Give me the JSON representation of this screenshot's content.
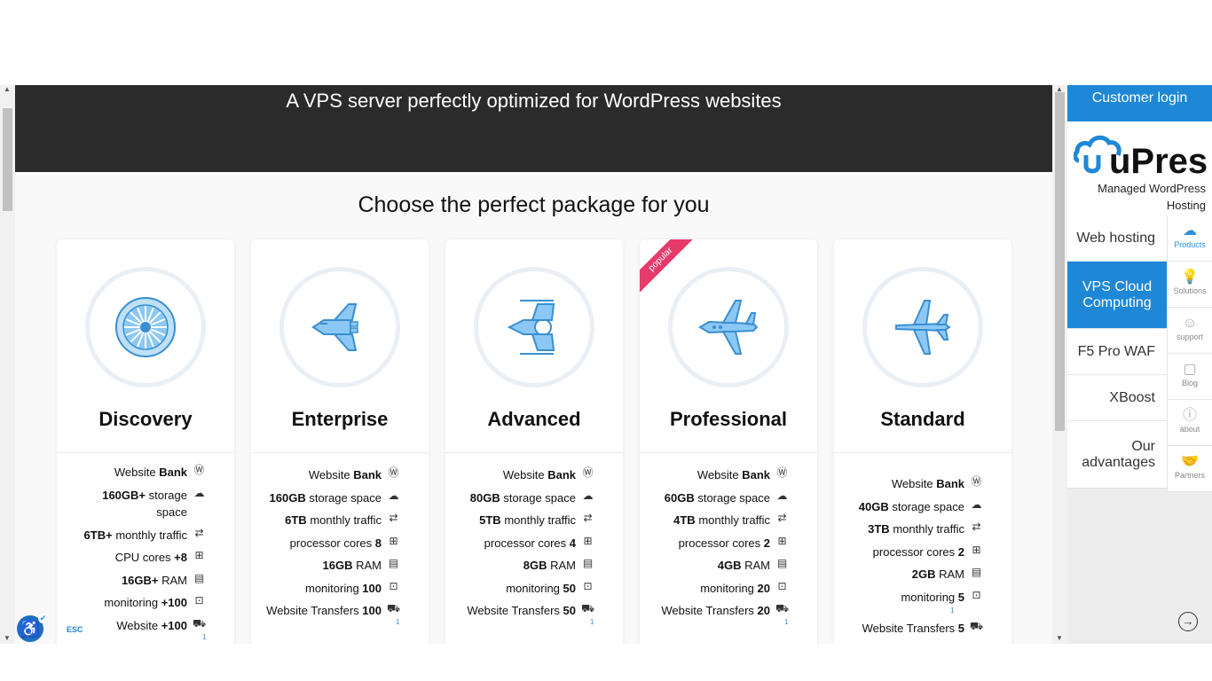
{
  "hero": {
    "title": "A VPS server perfectly optimized for WordPress websites"
  },
  "section": {
    "title": "Choose the perfect package for you"
  },
  "cards": [
    {
      "name": "Discovery",
      "icon": "turbine-icon",
      "features": [
        {
          "pre": "Website ",
          "bold": "Bank",
          "icon": "wordpress-icon"
        },
        {
          "pre": "",
          "bold": "160GB+",
          "post": " storage",
          "post2": "space",
          "icon": "cloud-icon"
        },
        {
          "pre": "",
          "bold": "6TB+",
          "post": " monthly traffic",
          "icon": "transfer-arrows-icon"
        },
        {
          "pre": "CPU cores ",
          "bold": "+8",
          "icon": "cpu-icon"
        },
        {
          "pre": "",
          "bold": "16GB+",
          "post": " RAM",
          "icon": "ram-icon"
        },
        {
          "pre": "monitoring ",
          "bold": "+100",
          "icon": "monitor-icon"
        },
        {
          "pre": "Website ",
          "bold": "+100",
          "icon": "truck-icon"
        }
      ],
      "sup": "1"
    },
    {
      "name": "Enterprise",
      "icon": "space-shuttle-icon",
      "features": [
        {
          "pre": "Website ",
          "bold": "Bank",
          "icon": "wordpress-icon"
        },
        {
          "pre": "",
          "bold": "160GB",
          "post": " storage space",
          "icon": "cloud-icon"
        },
        {
          "pre": "",
          "bold": "6TB",
          "post": " monthly traffic",
          "icon": "transfer-arrows-icon"
        },
        {
          "pre": "processor cores ",
          "bold": "8",
          "icon": "cpu-icon"
        },
        {
          "pre": "",
          "bold": "16GB",
          "post": " RAM",
          "icon": "ram-icon"
        },
        {
          "pre": "monitoring ",
          "bold": "100",
          "icon": "monitor-icon"
        },
        {
          "pre": "Website Transfers ",
          "bold": "100",
          "icon": "truck-icon"
        }
      ],
      "sup": "1"
    },
    {
      "name": "Advanced",
      "icon": "starfighter-icon",
      "features": [
        {
          "pre": "Website ",
          "bold": "Bank",
          "icon": "wordpress-icon"
        },
        {
          "pre": "",
          "bold": "80GB",
          "post": " storage space",
          "icon": "cloud-icon"
        },
        {
          "pre": "",
          "bold": "5TB",
          "post": " monthly traffic",
          "icon": "transfer-arrows-icon"
        },
        {
          "pre": "processor cores ",
          "bold": "4",
          "icon": "cpu-icon"
        },
        {
          "pre": "",
          "bold": "8GB",
          "post": " RAM",
          "icon": "ram-icon"
        },
        {
          "pre": "monitoring ",
          "bold": "50",
          "icon": "monitor-icon"
        },
        {
          "pre": "Website Transfers ",
          "bold": "50",
          "icon": "truck-icon"
        }
      ],
      "sup": "1"
    },
    {
      "name": "Professional",
      "icon": "jet-icon",
      "ribbon": "popular",
      "features": [
        {
          "pre": "Website ",
          "bold": "Bank",
          "icon": "wordpress-icon"
        },
        {
          "pre": "",
          "bold": "60GB",
          "post": " storage space",
          "icon": "cloud-icon"
        },
        {
          "pre": "",
          "bold": "4TB",
          "post": " monthly traffic",
          "icon": "transfer-arrows-icon"
        },
        {
          "pre": "processor cores ",
          "bold": "2",
          "icon": "cpu-icon"
        },
        {
          "pre": "",
          "bold": "4GB",
          "post": " RAM",
          "icon": "ram-icon"
        },
        {
          "pre": "monitoring ",
          "bold": "20",
          "icon": "monitor-icon"
        },
        {
          "pre": "Website Transfers ",
          "bold": "20",
          "icon": "truck-icon"
        }
      ],
      "sup": "1"
    },
    {
      "name": "Standard",
      "icon": "airplane-icon",
      "features": [
        {
          "pre": "Website ",
          "bold": "Bank",
          "icon": "wordpress-icon"
        },
        {
          "pre": "",
          "bold": "40GB",
          "post": " storage space",
          "icon": "cloud-icon"
        },
        {
          "pre": "",
          "bold": "3TB",
          "post": " monthly traffic",
          "icon": "transfer-arrows-icon"
        },
        {
          "pre": "processor cores ",
          "bold": "2",
          "icon": "cpu-icon"
        },
        {
          "pre": "",
          "bold": "2GB",
          "post": " RAM",
          "icon": "ram-icon"
        },
        {
          "pre": "monitoring ",
          "bold": "5",
          "icon": "monitor-icon"
        },
        {
          "pre": "Website Transfers ",
          "bold": "5",
          "icon": "truck-icon"
        }
      ],
      "sup": "1"
    }
  ],
  "sidebar": {
    "login": "Customer login",
    "brand": "uPress",
    "tagline": "Managed WordPress Hosting",
    "menu": [
      "Web hosting",
      "VPS Cloud Computing",
      "F5 Pro WAF",
      "XBoost",
      "Our advantages"
    ],
    "icons": [
      {
        "label": "Products",
        "icon": "cloud-icon"
      },
      {
        "label": "Solutions",
        "icon": "lightbulb-icon"
      },
      {
        "label": "support",
        "icon": "support-agent-icon"
      },
      {
        "label": "Blog",
        "icon": "chat-bubble-icon"
      },
      {
        "label": "about",
        "icon": "info-icon"
      },
      {
        "label": "Partners",
        "icon": "handshake-icon"
      }
    ]
  },
  "accessibility": {
    "esc": "ESC"
  },
  "colors": {
    "accent": "#1e88d6",
    "hero_bg": "#2b2b2b",
    "ribbon": "#e63b6a"
  }
}
